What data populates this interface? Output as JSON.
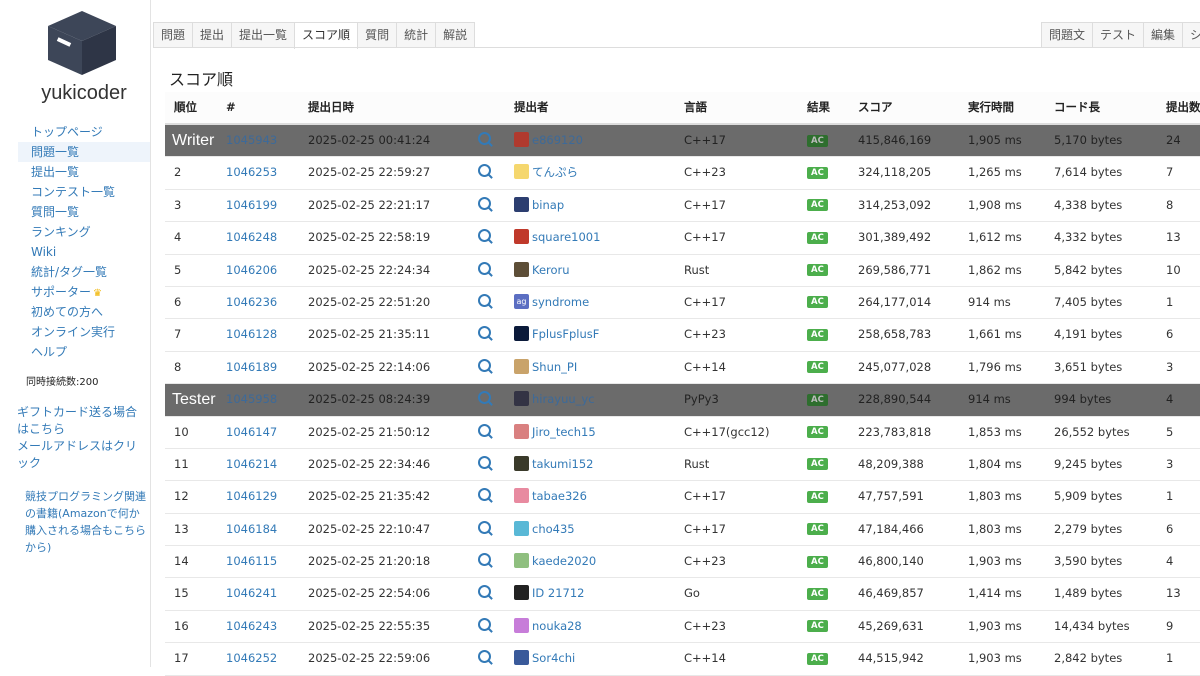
{
  "brand": "yukicoder",
  "nav": [
    {
      "label": "トップページ",
      "active": false
    },
    {
      "label": "問題一覧",
      "active": true
    },
    {
      "label": "提出一覧",
      "active": false
    },
    {
      "label": "コンテスト一覧",
      "active": false
    },
    {
      "label": "質問一覧",
      "active": false
    },
    {
      "label": "ランキング",
      "active": false
    },
    {
      "label": "Wiki",
      "active": false
    },
    {
      "label": "統計/タグ一覧",
      "active": false
    },
    {
      "label": "サポーター",
      "active": false
    },
    {
      "label": "初めての方へ",
      "active": false
    },
    {
      "label": "オンライン実行",
      "active": false
    },
    {
      "label": "ヘルプ",
      "active": false
    }
  ],
  "concurrent": "同時接続数:200",
  "gift": "ギフトカード送る場合はこちら",
  "mail": "メールアドレスはクリック",
  "books": "競技プログラミング関連の書籍(Amazonで何か購入される場合もこちらから)",
  "tabs_left": [
    "問題",
    "提出",
    "提出一覧",
    "スコア順",
    "質問",
    "統計",
    "解説"
  ],
  "active_tab": "スコア順",
  "tabs_right": [
    "問題文",
    "テスト",
    "編集",
    "シ"
  ],
  "page_title": "スコア順",
  "headers": {
    "rank": "順位",
    "id": "#",
    "date": "提出日時",
    "user": "提出者",
    "lang": "言語",
    "result": "結果",
    "score": "スコア",
    "time": "実行時間",
    "code": "コード長",
    "subs": "提出数"
  },
  "rows": [
    {
      "band": "Writer",
      "rank": "",
      "id": "1045943",
      "date": "2025-02-25 00:41:24",
      "user": "e869120",
      "lang": "C++17",
      "result": "AC",
      "score": "415,846,169",
      "time": "1,905 ms",
      "code": "5,170 bytes",
      "subs": "24",
      "avatar": "#b03a2e"
    },
    {
      "rank": "2",
      "id": "1046253",
      "date": "2025-02-25 22:59:27",
      "user": "てんぷら",
      "lang": "C++23",
      "result": "AC",
      "score": "324,118,205",
      "time": "1,265 ms",
      "code": "7,614 bytes",
      "subs": "7",
      "avatar": "#f5d76e"
    },
    {
      "rank": "3",
      "id": "1046199",
      "date": "2025-02-25 22:21:17",
      "user": "binap",
      "lang": "C++17",
      "result": "AC",
      "score": "314,253,092",
      "time": "1,908 ms",
      "code": "4,338 bytes",
      "subs": "8",
      "avatar": "#2c3e70"
    },
    {
      "rank": "4",
      "id": "1046248",
      "date": "2025-02-25 22:58:19",
      "user": "square1001",
      "lang": "C++17",
      "result": "AC",
      "score": "301,389,492",
      "time": "1,612 ms",
      "code": "4,332 bytes",
      "subs": "13",
      "avatar": "#c0392b"
    },
    {
      "rank": "5",
      "id": "1046206",
      "date": "2025-02-25 22:24:34",
      "user": "Keroru",
      "lang": "Rust",
      "result": "AC",
      "score": "269,586,771",
      "time": "1,862 ms",
      "code": "5,842 bytes",
      "subs": "10",
      "avatar": "#5d4e37"
    },
    {
      "rank": "6",
      "id": "1046236",
      "date": "2025-02-25 22:51:20",
      "user": "syndrome",
      "lang": "C++17",
      "result": "AC",
      "score": "264,177,014",
      "time": "914 ms",
      "code": "7,405 bytes",
      "subs": "1",
      "avatar": "#5b6ec2",
      "avatar_text": "ag"
    },
    {
      "rank": "7",
      "id": "1046128",
      "date": "2025-02-25 21:35:11",
      "user": "FplusFplusF",
      "lang": "C++23",
      "result": "AC",
      "score": "258,658,783",
      "time": "1,661 ms",
      "code": "4,191 bytes",
      "subs": "6",
      "avatar": "#0b1a3a"
    },
    {
      "rank": "8",
      "id": "1046189",
      "date": "2025-02-25 22:14:06",
      "user": "Shun_PI",
      "lang": "C++14",
      "result": "AC",
      "score": "245,077,028",
      "time": "1,796 ms",
      "code": "3,651 bytes",
      "subs": "3",
      "avatar": "#c9a36a"
    },
    {
      "band": "Tester",
      "rank": "",
      "id": "1045958",
      "date": "2025-02-25 08:24:39",
      "user": "hirayuu_yc",
      "lang": "PyPy3",
      "result": "AC",
      "score": "228,890,544",
      "time": "914 ms",
      "code": "994 bytes",
      "subs": "4",
      "avatar": "#334"
    },
    {
      "rank": "10",
      "id": "1046147",
      "date": "2025-02-25 21:50:12",
      "user": "Jiro_tech15",
      "lang": "C++17(gcc12)",
      "result": "AC",
      "score": "223,783,818",
      "time": "1,853 ms",
      "code": "26,552 bytes",
      "subs": "5",
      "avatar": "#d98080"
    },
    {
      "rank": "11",
      "id": "1046214",
      "date": "2025-02-25 22:34:46",
      "user": "takumi152",
      "lang": "Rust",
      "result": "AC",
      "score": "48,209,388",
      "time": "1,804 ms",
      "code": "9,245 bytes",
      "subs": "3",
      "avatar": "#3a3a2a"
    },
    {
      "rank": "12",
      "id": "1046129",
      "date": "2025-02-25 21:35:42",
      "user": "tabae326",
      "lang": "C++17",
      "result": "AC",
      "score": "47,757,591",
      "time": "1,803 ms",
      "code": "5,909 bytes",
      "subs": "1",
      "avatar": "#e88aa0"
    },
    {
      "rank": "13",
      "id": "1046184",
      "date": "2025-02-25 22:10:47",
      "user": "cho435",
      "lang": "C++17",
      "result": "AC",
      "score": "47,184,466",
      "time": "1,803 ms",
      "code": "2,279 bytes",
      "subs": "6",
      "avatar": "#59b8d6"
    },
    {
      "rank": "14",
      "id": "1046115",
      "date": "2025-02-25 21:20:18",
      "user": "kaede2020",
      "lang": "C++23",
      "result": "AC",
      "score": "46,800,140",
      "time": "1,903 ms",
      "code": "3,590 bytes",
      "subs": "4",
      "avatar": "#8fbf7f"
    },
    {
      "rank": "15",
      "id": "1046241",
      "date": "2025-02-25 22:54:06",
      "user": "ID 21712",
      "lang": "Go",
      "result": "AC",
      "score": "46,469,857",
      "time": "1,414 ms",
      "code": "1,489 bytes",
      "subs": "13",
      "avatar": "#222"
    },
    {
      "rank": "16",
      "id": "1046243",
      "date": "2025-02-25 22:55:35",
      "user": "nouka28",
      "lang": "C++23",
      "result": "AC",
      "score": "45,269,631",
      "time": "1,903 ms",
      "code": "14,434 bytes",
      "subs": "9",
      "avatar": "#c77dd9"
    },
    {
      "rank": "17",
      "id": "1046252",
      "date": "2025-02-25 22:59:06",
      "user": "Sor4chi",
      "lang": "C++14",
      "result": "AC",
      "score": "44,515,942",
      "time": "1,903 ms",
      "code": "2,842 bytes",
      "subs": "1",
      "avatar": "#3a5a9a"
    }
  ]
}
